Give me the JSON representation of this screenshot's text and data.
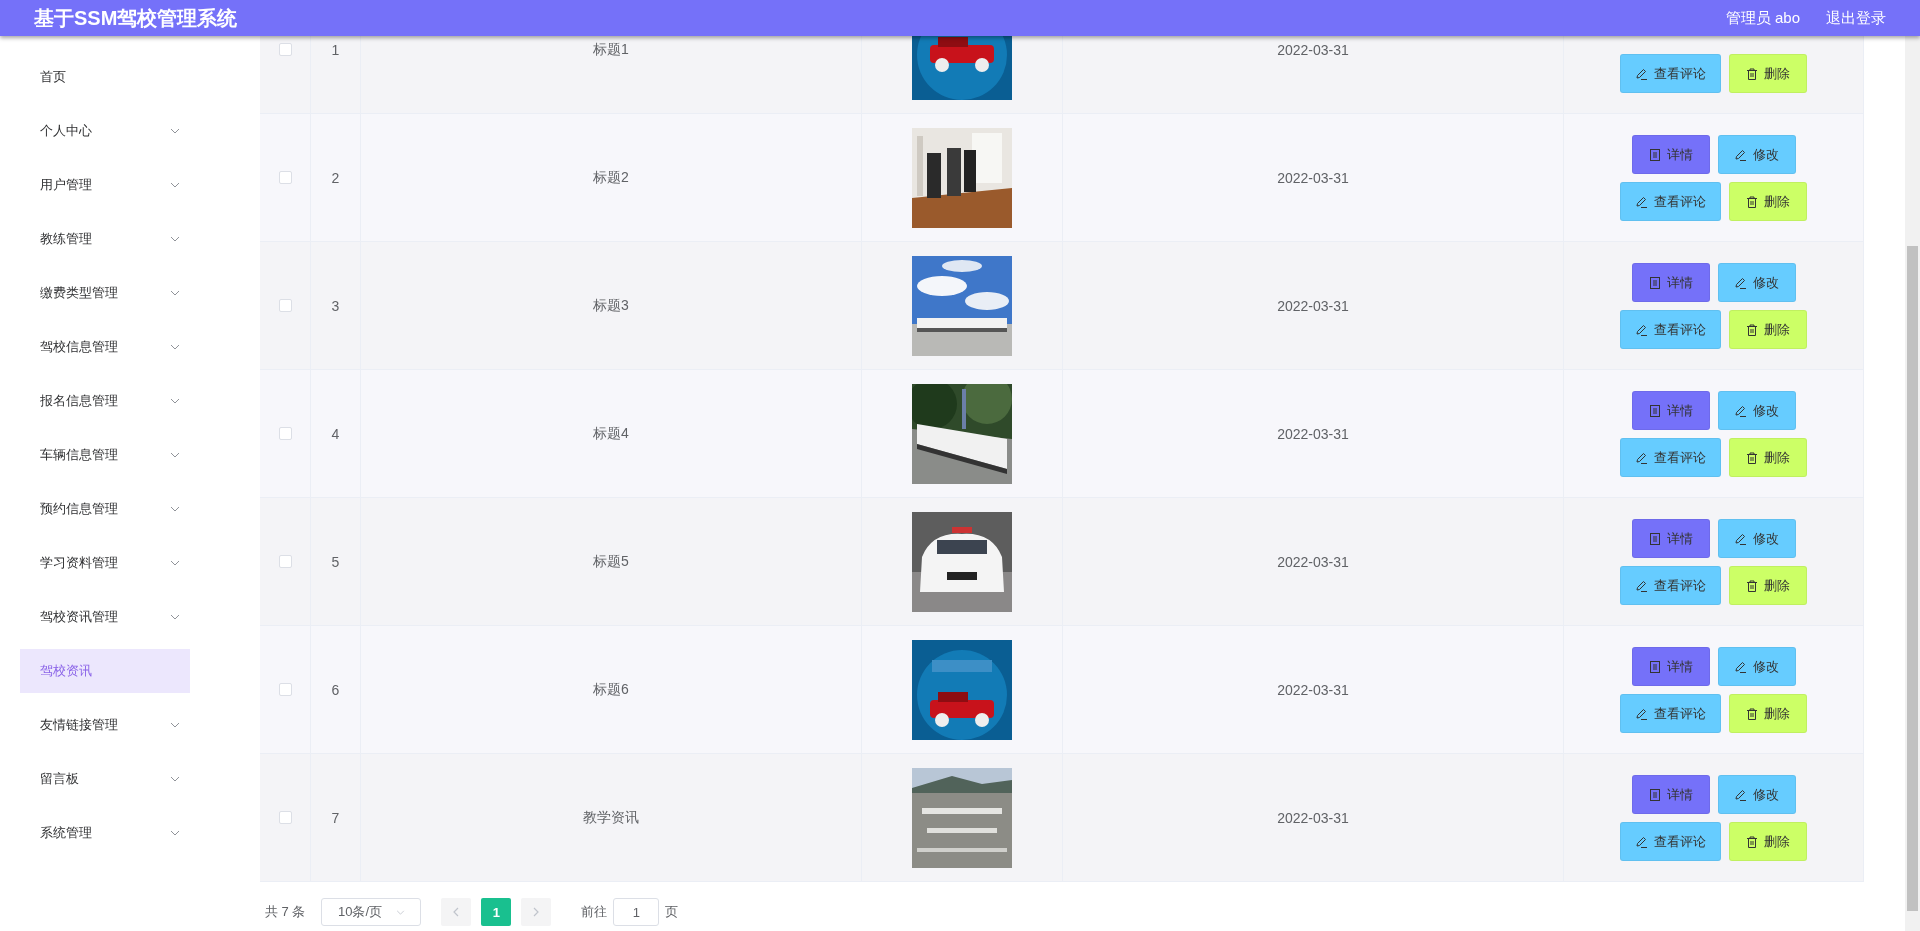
{
  "header": {
    "title": "基于SSM驾校管理系统",
    "user": "管理员 abo",
    "logout": "退出登录"
  },
  "sidebar": {
    "items": [
      {
        "kind": "link",
        "label": "首页",
        "selected": false
      },
      {
        "kind": "submenu",
        "label": "个人中心",
        "selected": false
      },
      {
        "kind": "submenu",
        "label": "用户管理",
        "selected": false
      },
      {
        "kind": "submenu",
        "label": "教练管理",
        "selected": false
      },
      {
        "kind": "submenu",
        "label": "缴费类型管理",
        "selected": false
      },
      {
        "kind": "submenu",
        "label": "驾校信息管理",
        "selected": false
      },
      {
        "kind": "submenu",
        "label": "报名信息管理",
        "selected": false
      },
      {
        "kind": "submenu",
        "label": "车辆信息管理",
        "selected": false
      },
      {
        "kind": "submenu",
        "label": "预约信息管理",
        "selected": false
      },
      {
        "kind": "submenu",
        "label": "学习资料管理",
        "selected": false
      },
      {
        "kind": "submenu",
        "label": "驾校资讯管理",
        "selected": false,
        "children": [
          {
            "label": "驾校资讯",
            "selected": true
          }
        ]
      },
      {
        "kind": "submenu",
        "label": "友情链接管理",
        "selected": false
      },
      {
        "kind": "submenu",
        "label": "留言板",
        "selected": false
      },
      {
        "kind": "submenu",
        "label": "系统管理",
        "selected": false
      }
    ]
  },
  "table": {
    "rows": [
      {
        "checked": false,
        "index": "1",
        "title": "标题1",
        "picture": {
          "kind": "picture"
        },
        "date": "2022-03-31",
        "button_lines": [
          [
            {
              "kind": "comments",
              "label": "查看评论"
            },
            {
              "kind": "delete",
              "label": "删除"
            }
          ]
        ]
      },
      {
        "checked": false,
        "index": "2",
        "title": "标题2",
        "picture": {
          "kind": "picture"
        },
        "date": "2022-03-31",
        "button_lines": [
          [
            {
              "kind": "details",
              "label": "详情"
            },
            {
              "kind": "edit",
              "label": "修改"
            }
          ],
          [
            {
              "kind": "comments",
              "label": "查看评论"
            },
            {
              "kind": "delete",
              "label": "删除"
            }
          ]
        ]
      },
      {
        "checked": false,
        "index": "3",
        "title": "标题3",
        "picture": {
          "kind": "picture"
        },
        "date": "2022-03-31",
        "button_lines": [
          [
            {
              "kind": "details",
              "label": "详情"
            },
            {
              "kind": "edit",
              "label": "修改"
            }
          ],
          [
            {
              "kind": "comments",
              "label": "查看评论"
            },
            {
              "kind": "delete",
              "label": "删除"
            }
          ]
        ]
      },
      {
        "checked": false,
        "index": "4",
        "title": "标题4",
        "picture": {
          "kind": "picture"
        },
        "date": "2022-03-31",
        "button_lines": [
          [
            {
              "kind": "details",
              "label": "详情"
            },
            {
              "kind": "edit",
              "label": "修改"
            }
          ],
          [
            {
              "kind": "comments",
              "label": "查看评论"
            },
            {
              "kind": "delete",
              "label": "删除"
            }
          ]
        ]
      },
      {
        "checked": false,
        "index": "5",
        "title": "标题5",
        "picture": {
          "kind": "picture"
        },
        "date": "2022-03-31",
        "button_lines": [
          [
            {
              "kind": "details",
              "label": "详情"
            },
            {
              "kind": "edit",
              "label": "修改"
            }
          ],
          [
            {
              "kind": "comments",
              "label": "查看评论"
            },
            {
              "kind": "delete",
              "label": "删除"
            }
          ]
        ]
      },
      {
        "checked": false,
        "index": "6",
        "title": "标题6",
        "picture": {
          "kind": "picture"
        },
        "date": "2022-03-31",
        "button_lines": [
          [
            {
              "kind": "details",
              "label": "详情"
            },
            {
              "kind": "edit",
              "label": "修改"
            }
          ],
          [
            {
              "kind": "comments",
              "label": "查看评论"
            },
            {
              "kind": "delete",
              "label": "删除"
            }
          ]
        ]
      },
      {
        "checked": false,
        "index": "7",
        "title": "教学资讯",
        "picture": {
          "kind": "picture"
        },
        "date": "2022-03-31",
        "button_lines": [
          [
            {
              "kind": "details",
              "label": "详情"
            },
            {
              "kind": "edit",
              "label": "修改"
            }
          ],
          [
            {
              "kind": "comments",
              "label": "查看评论"
            },
            {
              "kind": "delete",
              "label": "删除"
            }
          ]
        ]
      }
    ]
  },
  "pagination": {
    "total": "共 7 条",
    "page_size": "10条/页",
    "pages": [
      {
        "label": "1",
        "selected": true
      }
    ],
    "goto_label": "前往",
    "goto_value": "1",
    "goto_suffix": "页"
  }
}
